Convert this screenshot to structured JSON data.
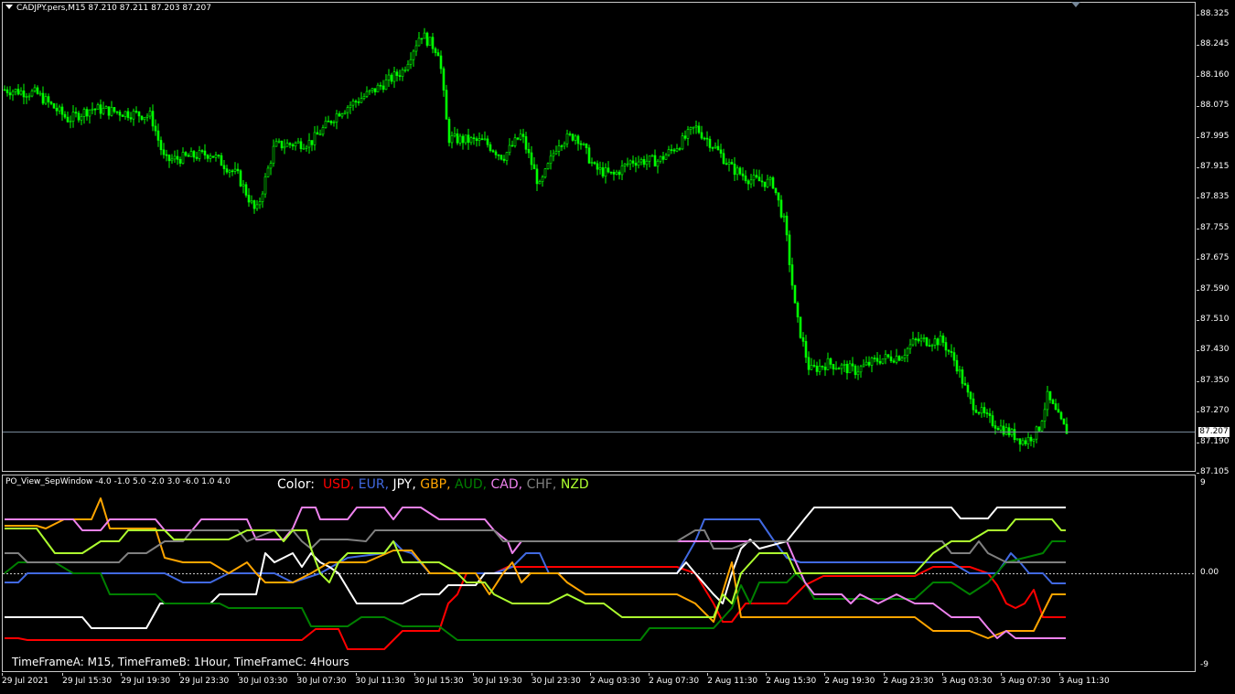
{
  "main_chart": {
    "symbol_title": "CADJPY.pers,M15  87.210 87.211 87.203 87.207",
    "current_price": "87.207",
    "price_ticks": [
      "88.325",
      "88.245",
      "88.160",
      "88.075",
      "87.995",
      "87.915",
      "87.835",
      "87.755",
      "87.675",
      "87.590",
      "87.510",
      "87.430",
      "87.350",
      "87.270",
      "87.190",
      "87.105"
    ],
    "candle_color": "#00ff00",
    "price_line_color": "#778899"
  },
  "indicator": {
    "title": "PO_View_SepWindow -4.0 -1.0 5.0 -2.0 3.0 -6.0 1.0 4.0",
    "legend_prefix": "Color:",
    "legend": [
      {
        "text": "USD,",
        "color": "#ff0000"
      },
      {
        "text": "EUR,",
        "color": "#4169e1"
      },
      {
        "text": "JPY,",
        "color": "#ffffff"
      },
      {
        "text": "GBP,",
        "color": "#ffa500"
      },
      {
        "text": "AUD,",
        "color": "#008000"
      },
      {
        "text": "CAD,",
        "color": "#ee82ee"
      },
      {
        "text": "CHF,",
        "color": "#808080"
      },
      {
        "text": "NZD",
        "color": "#adff2f"
      }
    ],
    "timeframes": "TimeFrameA: M15, TimeFrameB: 1Hour, TimeFrameC: 4Hours",
    "scale_ticks": [
      "9",
      "0.00",
      "-9"
    ]
  },
  "time_axis": [
    "29 Jul 2021",
    "29 Jul 15:30",
    "29 Jul 19:30",
    "29 Jul 23:30",
    "30 Jul 03:30",
    "30 Jul 07:30",
    "30 Jul 11:30",
    "30 Jul 15:30",
    "30 Jul 19:30",
    "30 Jul 23:30",
    "2 Aug 03:30",
    "2 Aug 07:30",
    "2 Aug 11:30",
    "2 Aug 15:30",
    "2 Aug 19:30",
    "2 Aug 23:30",
    "3 Aug 03:30",
    "3 Aug 07:30",
    "3 Aug 11:30"
  ]
}
